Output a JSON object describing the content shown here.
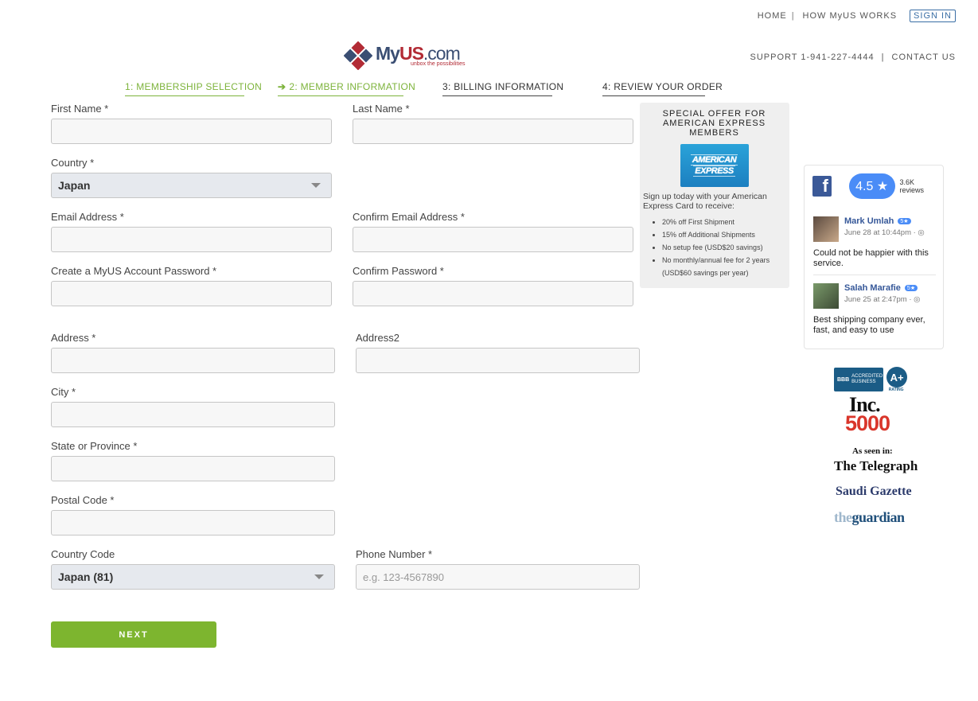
{
  "topnav": {
    "home": "HOME",
    "sep": "|",
    "how": "HOW MyUS WORKS",
    "signin": "SIGN IN"
  },
  "support": {
    "phone": "SUPPORT 1-941-227-4444",
    "sep": "|",
    "contact": "CONTACT US"
  },
  "logo": {
    "my": "My",
    "us": "US",
    "com": ".com",
    "tagline": "unbox the possibilities"
  },
  "steps": [
    {
      "label": "1: MEMBERSHIP SELECTION",
      "arrow": ""
    },
    {
      "label": "2: MEMBER INFORMATION",
      "arrow": "➔"
    },
    {
      "label": "3: BILLING INFORMATION",
      "arrow": ""
    },
    {
      "label": "4: REVIEW YOUR ORDER",
      "arrow": ""
    }
  ],
  "form": {
    "first_name": {
      "label": "First Name *",
      "value": ""
    },
    "last_name": {
      "label": "Last Name *",
      "value": ""
    },
    "country": {
      "label": "Country *",
      "value": "Japan"
    },
    "email": {
      "label": "Email Address *",
      "value": ""
    },
    "confirm_email": {
      "label": "Confirm Email Address *",
      "value": ""
    },
    "password": {
      "label": "Create a MyUS Account Password *",
      "value": ""
    },
    "confirm_password": {
      "label": "Confirm Password *",
      "value": ""
    },
    "address": {
      "label": "Address *",
      "value": ""
    },
    "address2": {
      "label": "Address2",
      "value": ""
    },
    "city": {
      "label": "City *",
      "value": ""
    },
    "state": {
      "label": "State or Province  *",
      "value": ""
    },
    "postal": {
      "label": "Postal Code  *",
      "value": ""
    },
    "country_code": {
      "label": "Country Code",
      "value": "Japan (81)"
    },
    "phone": {
      "label": "Phone Number *",
      "placeholder": "e.g. 123-4567890"
    },
    "next": "NEXT"
  },
  "offer": {
    "title": "SPECIAL OFFER FOR AMERICAN EXPRESS MEMBERS",
    "card_line1": "AMERICAN",
    "card_line2": "EXPRESS",
    "intro": "Sign up today with your American Express Card to receive:",
    "items": [
      "20% off First Shipment",
      "15% off Additional Shipments",
      "No setup fee (USD$20 savings)",
      "No monthly/annual fee for 2 years (USD$60 savings per year)"
    ]
  },
  "facebook": {
    "rating": "4.5 ★",
    "count": "3.6K reviews",
    "reviews": [
      {
        "name": "Mark Umlah",
        "badge": "5★",
        "date": "June 28 at 10:44pm · ◎",
        "text": "Could not be happier with this service."
      },
      {
        "name": "Salah Marafie",
        "badge": "5★",
        "date": "June 25 at 2:47pm · ◎",
        "text": "Best shipping company ever, fast, and easy to use"
      }
    ]
  },
  "badges": {
    "bbb_small": "BBB",
    "bbb_text": "ACCREDITED BUSINESS",
    "bbb_rating": "A+",
    "bbb_rating_word": "RATING",
    "inc": "Inc.",
    "inc_number": "5000",
    "seen": "As seen in:",
    "telegraph": "The Telegraph",
    "saudi": "Saudi Gazette",
    "guardian_the": "the",
    "guardian": "guardian"
  },
  "colors": {
    "accent_green": "#7db52f",
    "brand_red": "#b22b35",
    "brand_navy": "#3a4e73",
    "fb_blue": "#3b5998"
  }
}
